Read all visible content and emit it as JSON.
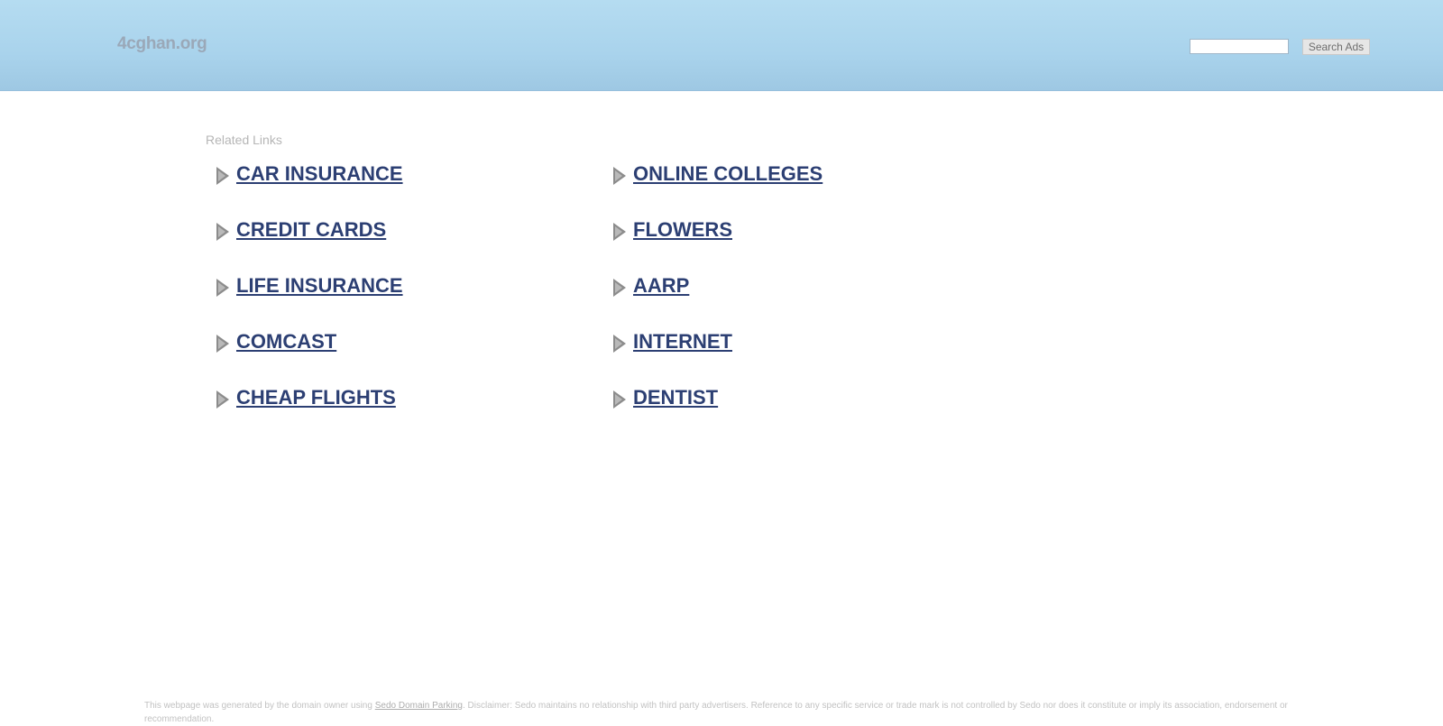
{
  "header": {
    "domain": "4cghan.org",
    "search_placeholder": "",
    "search_button": "Search Ads"
  },
  "main": {
    "related_label": "Related Links",
    "links": [
      "CAR INSURANCE",
      "CREDIT CARDS",
      "LIFE INSURANCE",
      "COMCAST",
      "CHEAP FLIGHTS",
      "ONLINE COLLEGES",
      "FLOWERS",
      "AARP",
      "INTERNET",
      "DENTIST"
    ]
  },
  "footer": {
    "prefix": "This webpage was generated by the domain owner using ",
    "link": "Sedo Domain Parking",
    "suffix": ". Disclaimer: Sedo maintains no relationship with third party advertisers. Reference to any specific service or trade mark is not controlled by Sedo nor does it constitute or imply its association, endorsement or recommendation."
  }
}
